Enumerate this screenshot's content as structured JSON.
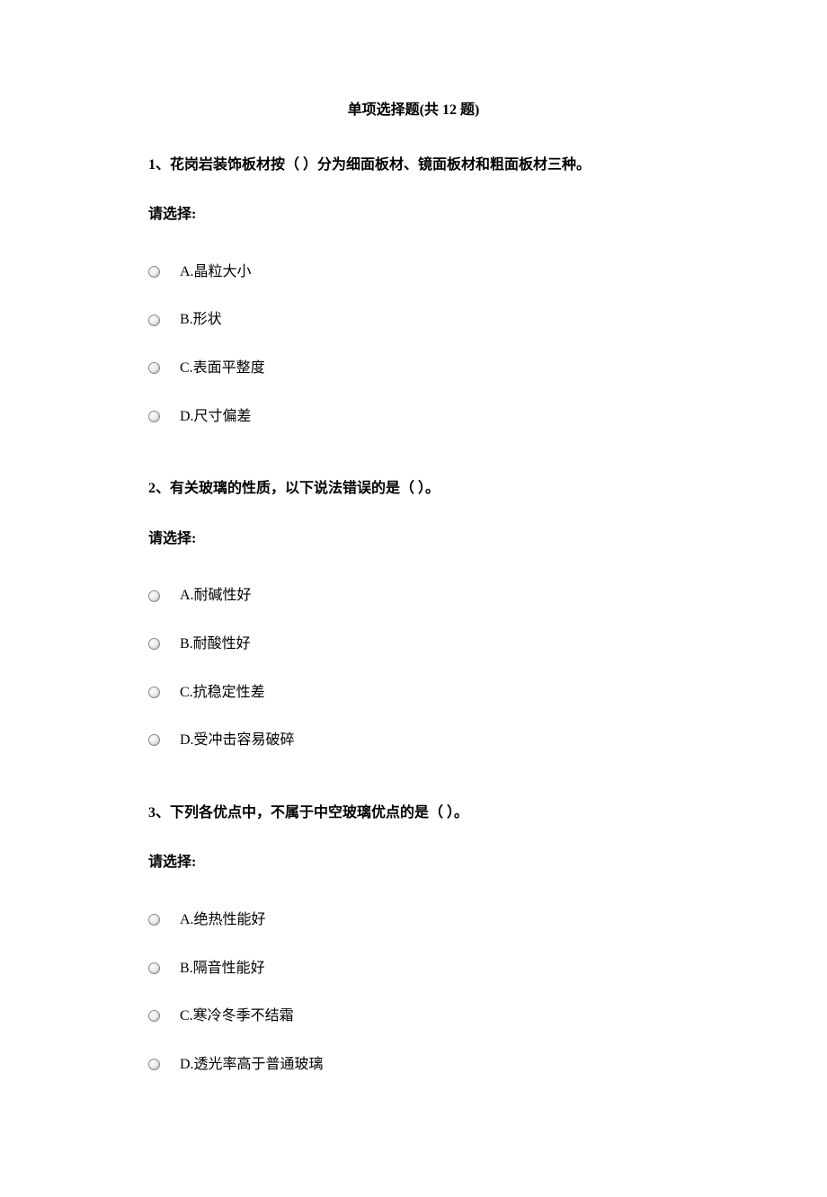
{
  "title": "单项选择题(共 12 题)",
  "questions": [
    {
      "stem": "1、花岗岩装饰板材按（ ）分为细面板材、镜面板材和粗面板材三种。",
      "prompt": "请选择:",
      "options": [
        "A.晶粒大小",
        "B.形状",
        "C.表面平整度",
        "D.尺寸偏差"
      ]
    },
    {
      "stem": "2、有关玻璃的性质，以下说法错误的是（ ）。",
      "prompt": "请选择:",
      "options": [
        "A.耐碱性好",
        "B.耐酸性好",
        "C.抗稳定性差",
        "D.受冲击容易破碎"
      ]
    },
    {
      "stem": "3、下列各优点中，不属于中空玻璃优点的是（ ）。",
      "prompt": "请选择:",
      "options": [
        "A.绝热性能好",
        "B.隔音性能好",
        "C.寒冷冬季不结霜",
        "D.透光率高于普通玻璃"
      ]
    }
  ]
}
